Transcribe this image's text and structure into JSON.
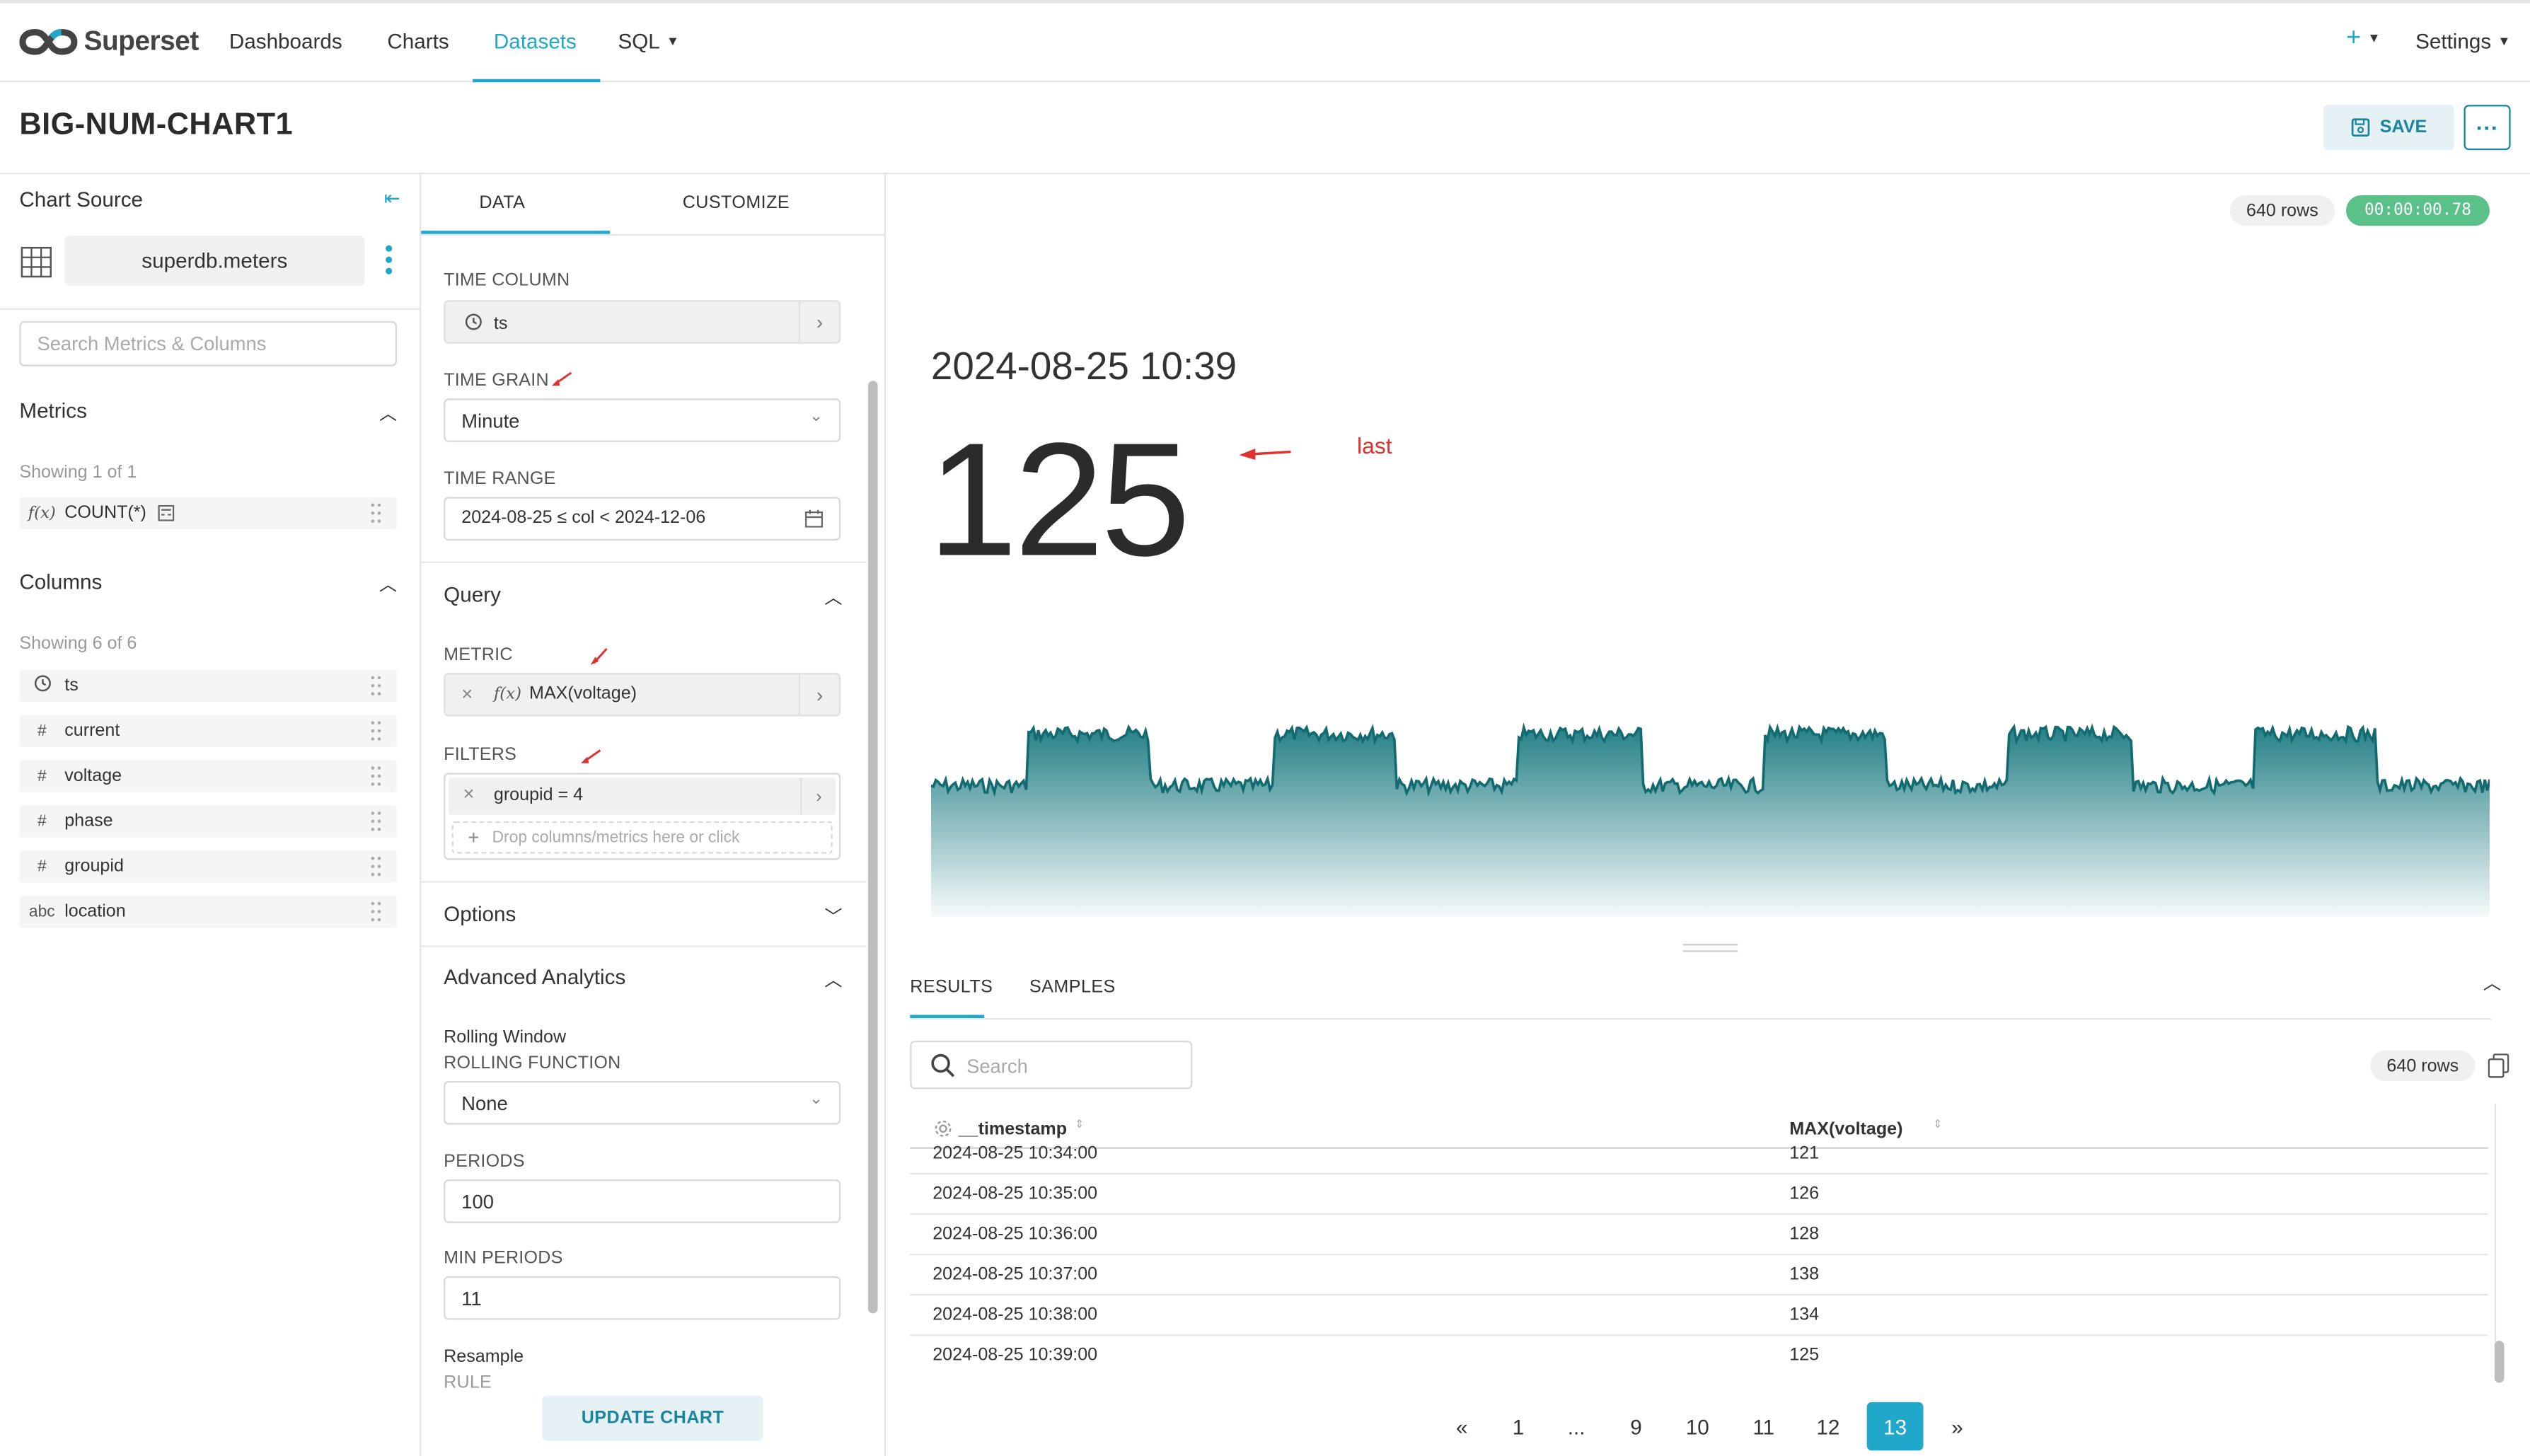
{
  "app": {
    "name": "Superset"
  },
  "nav": {
    "items": [
      "Dashboards",
      "Charts",
      "Datasets",
      "SQL"
    ],
    "active": "Datasets",
    "plus": "+",
    "settings": "Settings"
  },
  "header": {
    "title": "BIG-NUM-CHART1",
    "save_label": "SAVE",
    "more_label": "···"
  },
  "left": {
    "chart_source": "Chart Source",
    "dataset": "superdb.meters",
    "search_placeholder": "Search Metrics & Columns",
    "metrics": {
      "title": "Metrics",
      "showing": "Showing 1 of 1",
      "items": [
        {
          "type": "f(x)",
          "name": "COUNT(*)"
        }
      ]
    },
    "columns": {
      "title": "Columns",
      "showing": "Showing 6 of 6",
      "items": [
        {
          "type": "clock",
          "name": "ts"
        },
        {
          "type": "#",
          "name": "current"
        },
        {
          "type": "#",
          "name": "voltage"
        },
        {
          "type": "#",
          "name": "phase"
        },
        {
          "type": "#",
          "name": "groupid"
        },
        {
          "type": "abc",
          "name": "location"
        }
      ]
    }
  },
  "mid": {
    "tabs": [
      "DATA",
      "CUSTOMIZE"
    ],
    "time_column": {
      "label": "TIME COLUMN",
      "value": "ts"
    },
    "time_grain": {
      "label": "TIME GRAIN",
      "value": "Minute"
    },
    "time_range": {
      "label": "TIME RANGE",
      "value": "2024-08-25 ≤ col < 2024-12-06"
    },
    "query": {
      "title": "Query"
    },
    "metric": {
      "label": "METRIC",
      "fx": "f(x)",
      "value": "MAX(voltage)"
    },
    "filters": {
      "label": "FILTERS",
      "value": "groupid = 4",
      "drop_placeholder": "Drop columns/metrics here or click"
    },
    "options": {
      "title": "Options"
    },
    "advanced": {
      "title": "Advanced Analytics",
      "rolling_window": "Rolling Window",
      "rolling_function_label": "ROLLING FUNCTION",
      "rolling_function": "None",
      "periods_label": "PERIODS",
      "periods": "100",
      "min_periods_label": "MIN PERIODS",
      "min_periods": "11",
      "resample": "Resample",
      "rule_label": "RULE"
    },
    "update_label": "UPDATE CHART"
  },
  "right": {
    "rows_badge": "640 rows",
    "timer": "00:00:00.78",
    "big_date": "2024-08-25 10:39",
    "big_number": "125",
    "annotation": "last",
    "results_tabs": [
      "RESULTS",
      "SAMPLES"
    ],
    "search_placeholder": "Search",
    "rows_badge2": "640 rows",
    "table": {
      "headers": [
        "__timestamp",
        "MAX(voltage)"
      ],
      "rows": [
        [
          "2024-08-25 10:34:00",
          "121"
        ],
        [
          "2024-08-25 10:35:00",
          "126"
        ],
        [
          "2024-08-25 10:36:00",
          "128"
        ],
        [
          "2024-08-25 10:37:00",
          "138"
        ],
        [
          "2024-08-25 10:38:00",
          "134"
        ],
        [
          "2024-08-25 10:39:00",
          "125"
        ]
      ]
    },
    "pagination": [
      "«",
      "1",
      "...",
      "9",
      "10",
      "11",
      "12",
      "13",
      "»"
    ],
    "current_page": "13"
  },
  "colors": {
    "accent": "#20a7c9",
    "teal_series": "#1a7a80",
    "timer_badge": "#5ac189",
    "annotation": "#e03131"
  }
}
